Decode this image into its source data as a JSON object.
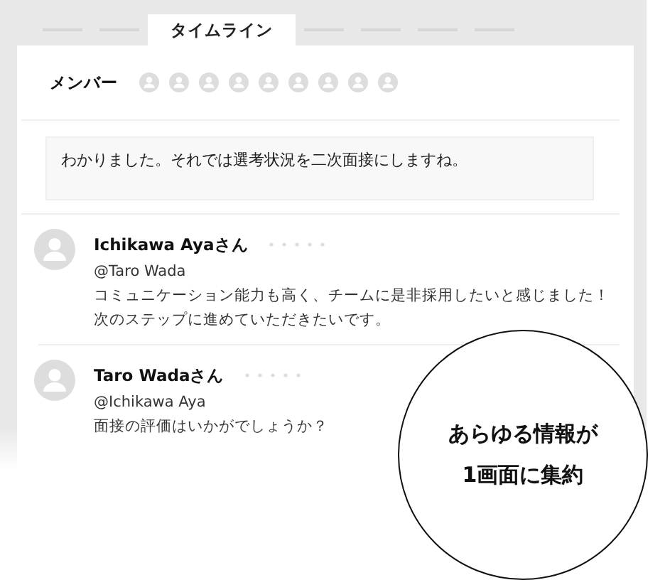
{
  "tabs": [
    {
      "label": "タイムライン",
      "selected": true
    }
  ],
  "members": {
    "label": "メンバー",
    "avatars": [
      {
        "kind": "avatar"
      },
      {
        "kind": "avatar"
      },
      {
        "kind": "avatar"
      },
      {
        "kind": "avatar"
      },
      {
        "kind": "avatar"
      },
      {
        "kind": "avatar"
      },
      {
        "kind": "avatar"
      },
      {
        "kind": "avatar"
      },
      {
        "kind": "avatar"
      }
    ]
  },
  "message": "わかりました。それでは選考状況を二次面接にしますね。",
  "comments": [
    {
      "name": "Ichikawa Ayaさん",
      "mention": "@Taro Wada",
      "body": [
        "コミュニケーション能力も高く、チームに是非採用したいと感じました！",
        "次のステップに進めていただきたいです。"
      ]
    },
    {
      "name": "Taro Wadaさん",
      "mention": "@Ichikawa Aya",
      "body": [
        "面接の評価はいかがでしょうか？"
      ]
    }
  ],
  "callout": [
    "あらゆる情報が",
    "1画面に集約"
  ]
}
